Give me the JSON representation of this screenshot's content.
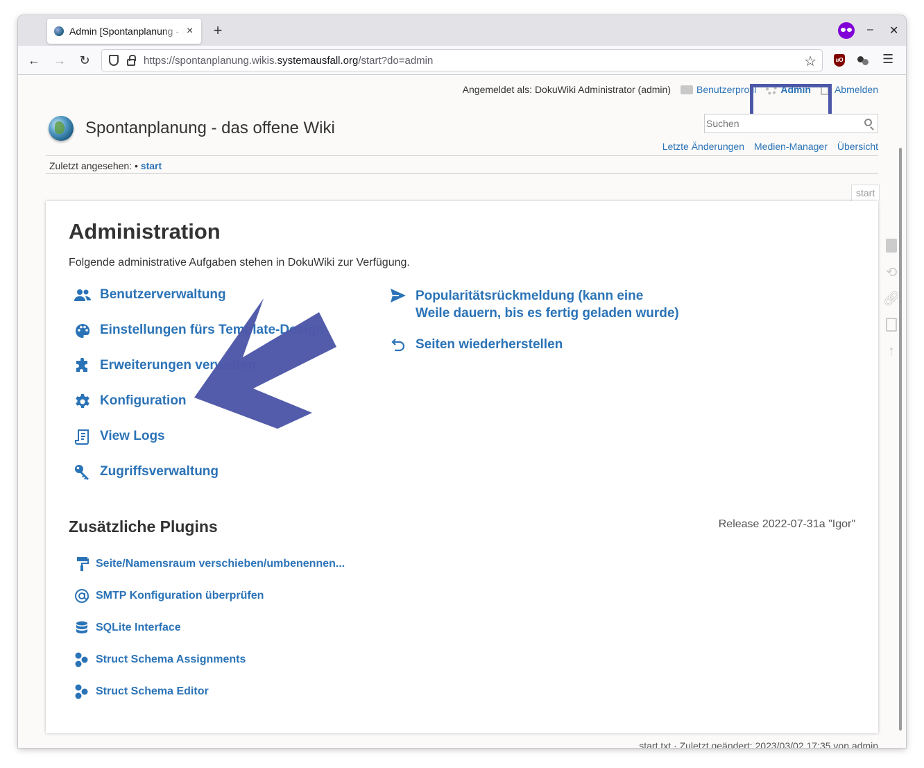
{
  "browser": {
    "tab_title": "Admin [Spontanplanung - das offene Wiki]",
    "url_prefix": "https://spontanplanung.wikis.",
    "url_host": "systemausfall.org",
    "url_path": "/start?do=admin"
  },
  "userbar": {
    "logged_in_as": "Angemeldet als: DokuWiki Administrator (admin)",
    "profile": "Benutzerprofil",
    "admin": "Admin",
    "logout": "Abmelden"
  },
  "site": {
    "title": "Spontanplanung - das offene Wiki",
    "search_placeholder": "Suchen",
    "tools": [
      "Letzte Änderungen",
      "Medien-Manager",
      "Übersicht"
    ]
  },
  "breadcrumbs": {
    "label": "Zuletzt angesehen:",
    "separator": " • ",
    "link": "start"
  },
  "pageid": "start",
  "content": {
    "title": "Administration",
    "intro": "Folgende administrative Aufgaben stehen in DokuWiki zur Verfügung.",
    "admin_left": [
      {
        "label": "Benutzerverwaltung",
        "icon": "users-icon"
      },
      {
        "label": "Einstellungen fürs Template-Design",
        "icon": "palette-icon"
      },
      {
        "label": "Erweiterungen verwalten",
        "icon": "puzzle-icon"
      },
      {
        "label": "Konfiguration",
        "icon": "gear-icon"
      },
      {
        "label": "View Logs",
        "icon": "logs-icon"
      },
      {
        "label": "Zugriffsverwaltung",
        "icon": "key-icon"
      }
    ],
    "admin_right": [
      {
        "label": "Popularitätsrückmeldung (kann eine Weile dauern, bis es fertig geladen wurde)",
        "icon": "send-icon"
      },
      {
        "label": "Seiten wiederherstellen",
        "icon": "undo-icon"
      }
    ],
    "plugins_title": "Zusätzliche Plugins",
    "release": "Release 2022-07-31a \"Igor\"",
    "plugins": [
      {
        "label": "Seite/Namensraum verschieben/umbenennen...",
        "icon": "paint-roller-icon"
      },
      {
        "label": "SMTP Konfiguration überprüfen",
        "icon": "at-icon"
      },
      {
        "label": "SQLite Interface",
        "icon": "database-icon"
      },
      {
        "label": "Struct Schema Assignments",
        "icon": "struct-icon"
      },
      {
        "label": "Struct Schema Editor",
        "icon": "struct-icon"
      }
    ]
  },
  "footer": "start.txt · Zuletzt geändert: 2023/03/02 17:35 von admin",
  "colors": {
    "link": "#2b73b7",
    "highlight": "#4d57a8",
    "arrow": "#4d57a8"
  }
}
